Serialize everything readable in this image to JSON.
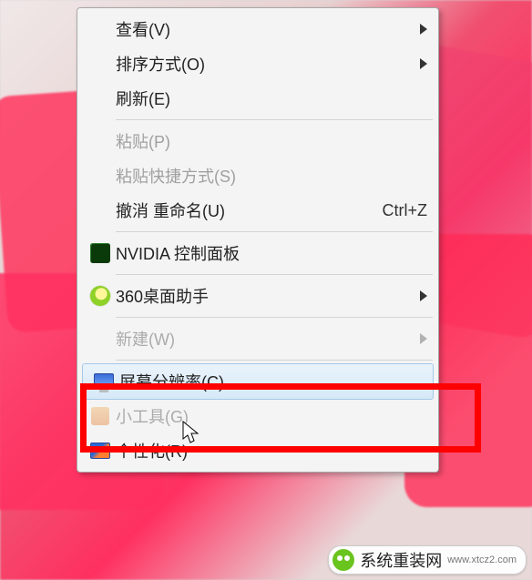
{
  "menu": {
    "items": [
      {
        "label": "查看(V)",
        "has_submenu": true
      },
      {
        "label": "排序方式(O)",
        "has_submenu": true
      },
      {
        "label": "刷新(E)"
      },
      {
        "sep": true
      },
      {
        "label": "粘贴(P)",
        "disabled": true
      },
      {
        "label": "粘贴快捷方式(S)",
        "disabled": true
      },
      {
        "label": "撤消 重命名(U)",
        "shortcut": "Ctrl+Z"
      },
      {
        "sep": true
      },
      {
        "label": "NVIDIA 控制面板",
        "icon": "nvidia"
      },
      {
        "sep": true
      },
      {
        "label": "360桌面助手",
        "icon": "360",
        "has_submenu": true
      },
      {
        "sep": true
      },
      {
        "label": "新建(W)",
        "has_submenu": true,
        "cut": true
      },
      {
        "sep": true
      },
      {
        "label": "屏幕分辨率(C)",
        "icon": "screen",
        "highlight": true
      },
      {
        "label": "小工具(G)",
        "icon": "tool",
        "cut": true
      },
      {
        "label": "个性化(R)",
        "icon": "pers"
      }
    ]
  },
  "watermark": {
    "text": "系统重装网",
    "site": "www.xtcz2.com"
  }
}
